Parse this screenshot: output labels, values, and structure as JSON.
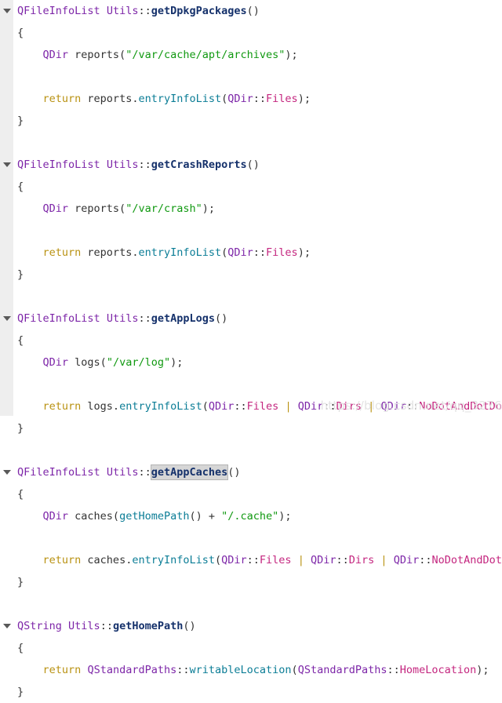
{
  "editor": {
    "background_color": "#ffffff",
    "gutter_color": "#eeeeee",
    "selection_color": "#d6d6d6",
    "watermark": "https://blog.csdn.net/qq_32768743",
    "fold_icon": "chevron-down-icon",
    "colors": {
      "type": "#7d26a8",
      "function_definition": "#15316b",
      "function_call": "#0b7d96",
      "string": "#119911",
      "keyword": "#b99212",
      "enum": "#c4267f",
      "plain": "#333333"
    }
  },
  "lines": [
    {
      "id": "line-1",
      "fold": true,
      "tokens": [
        {
          "t": "QFileInfoList",
          "c": "t-type"
        },
        {
          "t": " ",
          "c": "t-plain"
        },
        {
          "t": "Utils",
          "c": "t-class"
        },
        {
          "t": "::",
          "c": "t-punct"
        },
        {
          "t": "getDpkgPackages",
          "c": "t-func-def"
        },
        {
          "t": "()",
          "c": "t-punct"
        }
      ]
    },
    {
      "id": "line-2",
      "fold": false,
      "tokens": [
        {
          "t": "{",
          "c": "t-brace"
        }
      ]
    },
    {
      "id": "line-3",
      "fold": false,
      "tokens": [
        {
          "t": "    ",
          "c": "t-plain"
        },
        {
          "t": "QDir",
          "c": "t-type"
        },
        {
          "t": " reports(",
          "c": "t-plain"
        },
        {
          "t": "\"/var/cache/apt/archives\"",
          "c": "t-string"
        },
        {
          "t": ");",
          "c": "t-plain"
        }
      ]
    },
    {
      "id": "line-4",
      "fold": false,
      "tokens": [
        {
          "t": "",
          "c": "t-plain"
        }
      ]
    },
    {
      "id": "line-5",
      "fold": false,
      "tokens": [
        {
          "t": "    ",
          "c": "t-plain"
        },
        {
          "t": "return",
          "c": "t-keyword"
        },
        {
          "t": " reports.",
          "c": "t-plain"
        },
        {
          "t": "entryInfoList",
          "c": "t-func"
        },
        {
          "t": "(",
          "c": "t-plain"
        },
        {
          "t": "QDir",
          "c": "t-type"
        },
        {
          "t": "::",
          "c": "t-punct"
        },
        {
          "t": "Files",
          "c": "t-enum"
        },
        {
          "t": ");",
          "c": "t-plain"
        }
      ]
    },
    {
      "id": "line-6",
      "fold": false,
      "tokens": [
        {
          "t": "}",
          "c": "t-brace"
        }
      ]
    },
    {
      "id": "line-7",
      "fold": false,
      "tokens": [
        {
          "t": "",
          "c": "t-plain"
        }
      ]
    },
    {
      "id": "line-8",
      "fold": true,
      "tokens": [
        {
          "t": "QFileInfoList",
          "c": "t-type"
        },
        {
          "t": " ",
          "c": "t-plain"
        },
        {
          "t": "Utils",
          "c": "t-class"
        },
        {
          "t": "::",
          "c": "t-punct"
        },
        {
          "t": "getCrashReports",
          "c": "t-func-def"
        },
        {
          "t": "()",
          "c": "t-punct"
        }
      ]
    },
    {
      "id": "line-9",
      "fold": false,
      "tokens": [
        {
          "t": "{",
          "c": "t-brace"
        }
      ]
    },
    {
      "id": "line-10",
      "fold": false,
      "tokens": [
        {
          "t": "    ",
          "c": "t-plain"
        },
        {
          "t": "QDir",
          "c": "t-type"
        },
        {
          "t": " reports(",
          "c": "t-plain"
        },
        {
          "t": "\"/var/crash\"",
          "c": "t-string"
        },
        {
          "t": ");",
          "c": "t-plain"
        }
      ]
    },
    {
      "id": "line-11",
      "fold": false,
      "tokens": [
        {
          "t": "",
          "c": "t-plain"
        }
      ]
    },
    {
      "id": "line-12",
      "fold": false,
      "tokens": [
        {
          "t": "    ",
          "c": "t-plain"
        },
        {
          "t": "return",
          "c": "t-keyword"
        },
        {
          "t": " reports.",
          "c": "t-plain"
        },
        {
          "t": "entryInfoList",
          "c": "t-func"
        },
        {
          "t": "(",
          "c": "t-plain"
        },
        {
          "t": "QDir",
          "c": "t-type"
        },
        {
          "t": "::",
          "c": "t-punct"
        },
        {
          "t": "Files",
          "c": "t-enum"
        },
        {
          "t": ");",
          "c": "t-plain"
        }
      ]
    },
    {
      "id": "line-13",
      "fold": false,
      "tokens": [
        {
          "t": "}",
          "c": "t-brace"
        }
      ]
    },
    {
      "id": "line-14",
      "fold": false,
      "tokens": [
        {
          "t": "",
          "c": "t-plain"
        }
      ]
    },
    {
      "id": "line-15",
      "fold": true,
      "tokens": [
        {
          "t": "QFileInfoList",
          "c": "t-type"
        },
        {
          "t": " ",
          "c": "t-plain"
        },
        {
          "t": "Utils",
          "c": "t-class"
        },
        {
          "t": "::",
          "c": "t-punct"
        },
        {
          "t": "getAppLogs",
          "c": "t-func-def"
        },
        {
          "t": "()",
          "c": "t-punct"
        }
      ]
    },
    {
      "id": "line-16",
      "fold": false,
      "tokens": [
        {
          "t": "{",
          "c": "t-brace"
        }
      ]
    },
    {
      "id": "line-17",
      "fold": false,
      "tokens": [
        {
          "t": "    ",
          "c": "t-plain"
        },
        {
          "t": "QDir",
          "c": "t-type"
        },
        {
          "t": " logs(",
          "c": "t-plain"
        },
        {
          "t": "\"/var/log\"",
          "c": "t-string"
        },
        {
          "t": ");",
          "c": "t-plain"
        }
      ]
    },
    {
      "id": "line-18",
      "fold": false,
      "tokens": [
        {
          "t": "",
          "c": "t-plain"
        }
      ]
    },
    {
      "id": "line-19",
      "fold": false,
      "tokens": [
        {
          "t": "    ",
          "c": "t-plain"
        },
        {
          "t": "return",
          "c": "t-keyword"
        },
        {
          "t": " logs.",
          "c": "t-plain"
        },
        {
          "t": "entryInfoList",
          "c": "t-func"
        },
        {
          "t": "(",
          "c": "t-plain"
        },
        {
          "t": "QDir",
          "c": "t-type"
        },
        {
          "t": "::",
          "c": "t-punct"
        },
        {
          "t": "Files",
          "c": "t-enum"
        },
        {
          "t": " ",
          "c": "t-plain"
        },
        {
          "t": "|",
          "c": "t-op"
        },
        {
          "t": " ",
          "c": "t-plain"
        },
        {
          "t": "QDir",
          "c": "t-type"
        },
        {
          "t": "::",
          "c": "t-punct"
        },
        {
          "t": "Dirs",
          "c": "t-enum"
        },
        {
          "t": " ",
          "c": "t-plain"
        },
        {
          "t": "|",
          "c": "t-op"
        },
        {
          "t": " ",
          "c": "t-plain"
        },
        {
          "t": "QDir",
          "c": "t-type"
        },
        {
          "t": "::",
          "c": "t-punct"
        },
        {
          "t": "NoDotAndDotDot",
          "c": "t-enum"
        },
        {
          "t": ");",
          "c": "t-plain"
        }
      ]
    },
    {
      "id": "line-20",
      "fold": false,
      "tokens": [
        {
          "t": "}",
          "c": "t-brace"
        }
      ]
    },
    {
      "id": "line-21",
      "fold": false,
      "tokens": [
        {
          "t": "",
          "c": "t-plain"
        }
      ]
    },
    {
      "id": "line-22",
      "fold": true,
      "caret_before_index": 4,
      "tokens": [
        {
          "t": "QFileInfoList",
          "c": "t-type"
        },
        {
          "t": " ",
          "c": "t-plain"
        },
        {
          "t": "Utils",
          "c": "t-class"
        },
        {
          "t": "::",
          "c": "t-punct"
        },
        {
          "t": "getAppCaches",
          "c": "t-func-def",
          "sel": true
        },
        {
          "t": "()",
          "c": "t-punct"
        }
      ]
    },
    {
      "id": "line-23",
      "fold": false,
      "tokens": [
        {
          "t": "{",
          "c": "t-brace"
        }
      ]
    },
    {
      "id": "line-24",
      "fold": false,
      "tokens": [
        {
          "t": "    ",
          "c": "t-plain"
        },
        {
          "t": "QDir",
          "c": "t-type"
        },
        {
          "t": " caches(",
          "c": "t-plain"
        },
        {
          "t": "getHomePath",
          "c": "t-func"
        },
        {
          "t": "() + ",
          "c": "t-plain"
        },
        {
          "t": "\"/.cache\"",
          "c": "t-string"
        },
        {
          "t": ");",
          "c": "t-plain"
        }
      ]
    },
    {
      "id": "line-25",
      "fold": false,
      "tokens": [
        {
          "t": "",
          "c": "t-plain"
        }
      ]
    },
    {
      "id": "line-26",
      "fold": false,
      "tokens": [
        {
          "t": "    ",
          "c": "t-plain"
        },
        {
          "t": "return",
          "c": "t-keyword"
        },
        {
          "t": " caches.",
          "c": "t-plain"
        },
        {
          "t": "entryInfoList",
          "c": "t-func"
        },
        {
          "t": "(",
          "c": "t-plain"
        },
        {
          "t": "QDir",
          "c": "t-type"
        },
        {
          "t": "::",
          "c": "t-punct"
        },
        {
          "t": "Files",
          "c": "t-enum"
        },
        {
          "t": " ",
          "c": "t-plain"
        },
        {
          "t": "|",
          "c": "t-op"
        },
        {
          "t": " ",
          "c": "t-plain"
        },
        {
          "t": "QDir",
          "c": "t-type"
        },
        {
          "t": "::",
          "c": "t-punct"
        },
        {
          "t": "Dirs",
          "c": "t-enum"
        },
        {
          "t": " ",
          "c": "t-plain"
        },
        {
          "t": "|",
          "c": "t-op"
        },
        {
          "t": " ",
          "c": "t-plain"
        },
        {
          "t": "QDir",
          "c": "t-type"
        },
        {
          "t": "::",
          "c": "t-punct"
        },
        {
          "t": "NoDotAndDotDot",
          "c": "t-enum"
        },
        {
          "t": ");",
          "c": "t-plain"
        }
      ]
    },
    {
      "id": "line-27",
      "fold": false,
      "tokens": [
        {
          "t": "}",
          "c": "t-brace"
        }
      ]
    },
    {
      "id": "line-28",
      "fold": false,
      "tokens": [
        {
          "t": "",
          "c": "t-plain"
        }
      ]
    },
    {
      "id": "line-29",
      "fold": true,
      "tokens": [
        {
          "t": "QString",
          "c": "t-type"
        },
        {
          "t": " ",
          "c": "t-plain"
        },
        {
          "t": "Utils",
          "c": "t-class"
        },
        {
          "t": "::",
          "c": "t-punct"
        },
        {
          "t": "getHomePath",
          "c": "t-func-def"
        },
        {
          "t": "()",
          "c": "t-punct"
        }
      ]
    },
    {
      "id": "line-30",
      "fold": false,
      "tokens": [
        {
          "t": "{",
          "c": "t-brace"
        }
      ]
    },
    {
      "id": "line-31",
      "fold": false,
      "tokens": [
        {
          "t": "    ",
          "c": "t-plain"
        },
        {
          "t": "return",
          "c": "t-keyword"
        },
        {
          "t": " ",
          "c": "t-plain"
        },
        {
          "t": "QStandardPaths",
          "c": "t-type"
        },
        {
          "t": "::",
          "c": "t-punct"
        },
        {
          "t": "writableLocation",
          "c": "t-func"
        },
        {
          "t": "(",
          "c": "t-plain"
        },
        {
          "t": "QStandardPaths",
          "c": "t-type"
        },
        {
          "t": "::",
          "c": "t-punct"
        },
        {
          "t": "HomeLocation",
          "c": "t-enum"
        },
        {
          "t": ");",
          "c": "t-plain"
        }
      ]
    },
    {
      "id": "line-32",
      "fold": false,
      "tokens": [
        {
          "t": "}",
          "c": "t-brace"
        }
      ]
    }
  ]
}
